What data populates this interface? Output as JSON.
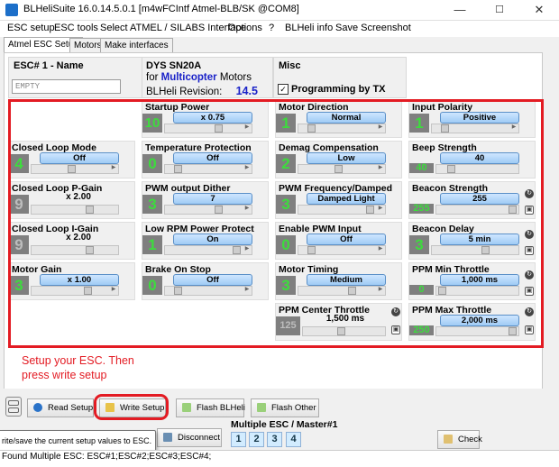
{
  "window": {
    "title": "BLHeliSuite 16.0.14.5.0.1  [m4wFCIntf Atmel-BLB/SK @COM8]",
    "minimize": "—",
    "maximize": "☐",
    "close": "✕"
  },
  "menu": [
    "ESC setup",
    "ESC tools",
    "Select ATMEL / SILABS Interface",
    "Options",
    "?",
    "BLHeli info",
    "Save Screenshot"
  ],
  "tabs": [
    "Atmel ESC Setup",
    "Motors",
    "Make interfaces"
  ],
  "esc_header": {
    "name_label": "ESC# 1 - Name",
    "name_value": "EMPTY",
    "model": "DYS SN20A",
    "for_text": "for",
    "type": "Multicopter",
    "motors_text": "Motors",
    "revision_label": "BLHeli Revision:",
    "revision_value": "14.5",
    "misc_label": "Misc",
    "programming_by_tx_label": "Programming by TX",
    "programming_by_tx_checked": true
  },
  "settings": {
    "closed_loop_mode": {
      "label": "Closed Loop Mode",
      "value": "Off",
      "num": "4"
    },
    "closed_loop_p_gain": {
      "label": "Closed Loop P-Gain",
      "value": "x 2.00",
      "num": "9"
    },
    "closed_loop_i_gain": {
      "label": "Closed Loop I-Gain",
      "value": "x 2.00",
      "num": "9"
    },
    "motor_gain": {
      "label": "Motor Gain",
      "value": "x 1.00",
      "num": "3"
    },
    "startup_power": {
      "label": "Startup Power",
      "value": "x 0.75",
      "num": "10"
    },
    "temperature_protection": {
      "label": "Temperature Protection",
      "value": "Off",
      "num": "0"
    },
    "pwm_output_dither": {
      "label": "PWM output Dither",
      "value": "7",
      "num": "3"
    },
    "low_rpm_power_protect": {
      "label": "Low RPM Power Protect",
      "value": "On",
      "num": "1"
    },
    "brake_on_stop": {
      "label": "Brake On Stop",
      "value": "Off",
      "num": "0"
    },
    "motor_direction": {
      "label": "Motor Direction",
      "value": "Normal",
      "num": "1"
    },
    "demag_compensation": {
      "label": "Demag Compensation",
      "value": "Low",
      "num": "2"
    },
    "pwm_frequency_damped": {
      "label": "PWM Frequency/Damped",
      "value": "Damped Light",
      "num": "3"
    },
    "enable_pwm_input": {
      "label": "Enable PWM Input",
      "value": "Off",
      "num": "0"
    },
    "motor_timing": {
      "label": "Motor Timing",
      "value": "Medium",
      "num": "3"
    },
    "ppm_center_throttle": {
      "label": "PPM Center Throttle",
      "value": "1,500 ms",
      "num": "125"
    },
    "input_polarity": {
      "label": "Input Polarity",
      "value": "Positive",
      "num": "1"
    },
    "beep_strength": {
      "label": "Beep Strength",
      "value": "40",
      "num": "40"
    },
    "beacon_strength": {
      "label": "Beacon Strength",
      "value": "255",
      "num": "255"
    },
    "beacon_delay": {
      "label": "Beacon Delay",
      "value": "5 min",
      "num": "3"
    },
    "ppm_min_throttle": {
      "label": "PPM Min Throttle",
      "value": "1,000 ms",
      "num": "0"
    },
    "ppm_max_throttle": {
      "label": "PPM Max Throttle",
      "value": "2,000 ms",
      "num": "250"
    }
  },
  "annotation": "Setup your ESC. Then press write setup",
  "buttons": {
    "read_setup": "Read Setup",
    "write_setup": "Write Setup",
    "flash_blheli": "Flash BLHeli",
    "flash_other": "Flash Other",
    "disconnect": "Disconnect",
    "check": "Check"
  },
  "multiple_esc": {
    "label": "Multiple ESC / Master#1",
    "escs": [
      "1",
      "2",
      "3",
      "4"
    ]
  },
  "tooltip": "rite/save the current setup values to ESC.",
  "status_bar": "Found Multiple ESC: ESC#1;ESC#2;ESC#3;ESC#4;",
  "colors": {
    "annotation_red": "#e31b23",
    "digit_green": "#3ddc3d",
    "value_blue": "#9fcbf5",
    "type_blue": "#1a22c8"
  }
}
